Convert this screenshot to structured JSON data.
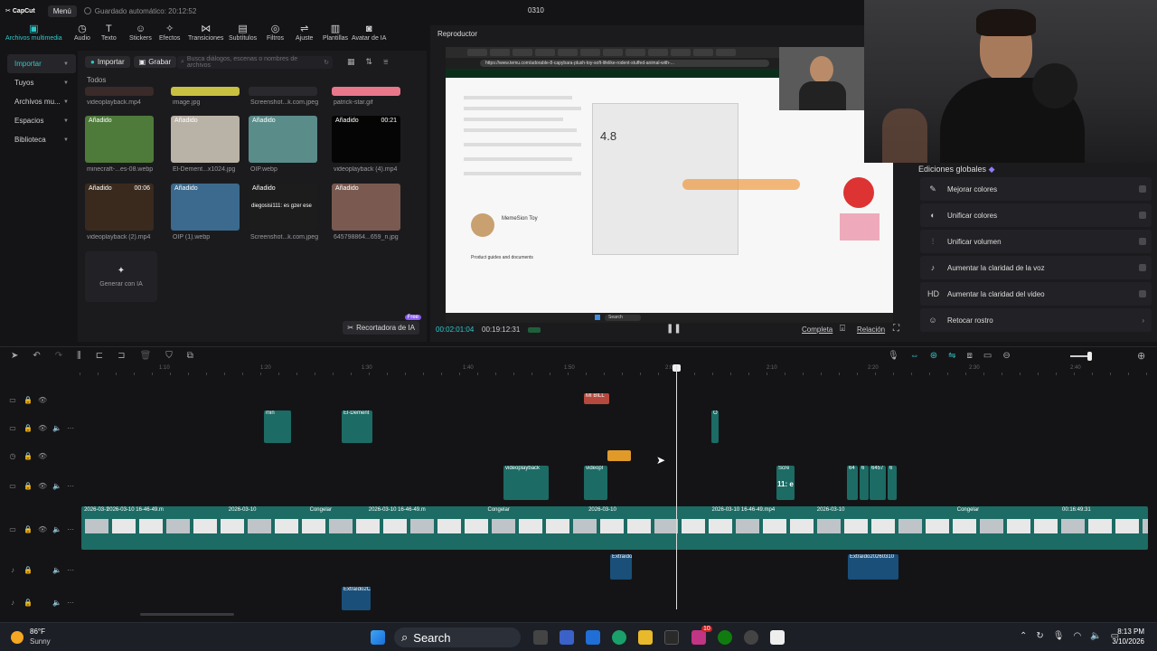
{
  "app": {
    "logo": "CapCut",
    "menu": "Menú",
    "autosave": "Guardado automático: 20:12:52",
    "project_title": "0310"
  },
  "toolbar": [
    {
      "label": "Archivos multimedia",
      "icon": "media-icon",
      "glyph": "▣",
      "active": true
    },
    {
      "label": "Audio",
      "icon": "audio-icon",
      "glyph": "◷"
    },
    {
      "label": "Texto",
      "icon": "text-icon",
      "glyph": "T"
    },
    {
      "label": "Stickers",
      "icon": "sticker-icon",
      "glyph": "☺"
    },
    {
      "label": "Efectos",
      "icon": "effects-icon",
      "glyph": "✧"
    },
    {
      "label": "Transiciones",
      "icon": "transitions-icon",
      "glyph": "⋈"
    },
    {
      "label": "Subtítulos",
      "icon": "subtitles-icon",
      "glyph": "▤"
    },
    {
      "label": "Filtros",
      "icon": "filters-icon",
      "glyph": "◎"
    },
    {
      "label": "Ajuste",
      "icon": "adjust-icon",
      "glyph": "⇌"
    },
    {
      "label": "Plantillas",
      "icon": "templates-icon",
      "glyph": "▥"
    },
    {
      "label": "Avatar de IA",
      "icon": "ai-avatar-icon",
      "glyph": "◙"
    }
  ],
  "nav": [
    {
      "label": "Importar",
      "active": true
    },
    {
      "label": "Tuyos"
    },
    {
      "label": "Archivos mu..."
    },
    {
      "label": "Espacios"
    },
    {
      "label": "Biblioteca"
    }
  ],
  "media": {
    "import_btn": "Importar",
    "record_btn": "Grabar",
    "search_placeholder": "Busca diálogos, escenas o nombres de archivos",
    "section": "Todos",
    "top_names": [
      "videoplayback.mp4",
      "image.jpg",
      "Screenshot...k.com.jpeg",
      "patrick-star.gif"
    ],
    "items": [
      {
        "badge": "Añadido",
        "duration": "",
        "name": "minecraft-...es-08.webp",
        "color": "#4e7a3a"
      },
      {
        "badge": "Añadido",
        "duration": "",
        "name": "El-Dement...x1024.jpg",
        "color": "#b9b2a6"
      },
      {
        "badge": "Añadido",
        "duration": "",
        "name": "OIP.webp",
        "color": "#5a8c8a"
      },
      {
        "badge": "Añadido",
        "duration": "00:21",
        "name": "videoplayback (4).mp4",
        "color": "#050505"
      },
      {
        "badge": "Añadido",
        "duration": "00:06",
        "name": "videoplayback (2).mp4",
        "color": "#3a2a1e"
      },
      {
        "badge": "Añadido",
        "duration": "",
        "name": "OIP (1).webp",
        "color": "#3c6a8e"
      },
      {
        "badge": "Añadido",
        "duration": "",
        "name": "Screenshot...k.com.jpeg",
        "color": "#1c1c1c",
        "overlay": "diegosisi111: es gzer ese"
      },
      {
        "badge": "Añadido",
        "duration": "",
        "name": "645798864...659_n.jpg",
        "color": "#7a5a50"
      }
    ],
    "generate_label": "Generar con IA",
    "recorta_label": "Recortadora de IA",
    "free_badge": "Free"
  },
  "player": {
    "title": "Reproductor",
    "current_time": "00:02:01:04",
    "total_time": "00:19:12:31",
    "full_label": "Completa",
    "ratio_label": "Relación",
    "url": "https://www.temu.com/adorable-8-capybara-plush-toy-soft-lifelike-rodent-stuffed-animal-with-...",
    "rating": "4.8",
    "seller": "MemeSion Toy",
    "section_text": "Product guides and documents",
    "search_label": "Search"
  },
  "global_edits": {
    "title": "Ediciones globales",
    "items": [
      {
        "label": "Mejorar colores",
        "icon": "enhance-colors-icon",
        "glyph": "✎"
      },
      {
        "label": "Unificar colores",
        "icon": "unify-colors-icon",
        "glyph": "◐"
      },
      {
        "label": "Unificar volumen",
        "icon": "unify-volume-icon",
        "glyph": "⫶"
      },
      {
        "label": "Aumentar la claridad de la voz",
        "icon": "voice-clarity-icon",
        "glyph": "♪"
      },
      {
        "label": "Aumentar la claridad del video",
        "icon": "video-clarity-icon",
        "glyph": "HD"
      },
      {
        "label": "Retocar rostro",
        "icon": "retouch-face-icon",
        "glyph": "☺"
      }
    ]
  },
  "timeline": {
    "ticks": [
      "1:10",
      "1:20",
      "1:30",
      "1:40",
      "1:50",
      "2:00",
      "2:10",
      "2:20",
      "2:30",
      "2:40"
    ],
    "text_clip": "MI BILL",
    "clips_video": [
      "min",
      "El-Dement",
      "O"
    ],
    "clips_video2": [
      "videoplayback",
      "videopl",
      "Scre",
      "64",
      "6",
      "6457",
      "6"
    ],
    "overlay_text": "11: e",
    "main_labels": [
      "2026-03-1",
      "2026-03-10 16-46-49.m",
      "2026-03-10",
      "Congelar",
      "2026-03-10 16-46-49.m",
      "Congelar",
      "2026-03-10",
      "2026-03-10 16-46-49.mp4",
      "2026-03-10",
      "Congelar",
      "00:16:49:31"
    ],
    "audio_clips": [
      "Extraído",
      "Extraído20260310",
      "Extraído2C"
    ]
  },
  "taskbar": {
    "weather_temp": "86°F",
    "weather_desc": "Sunny",
    "search": "Search",
    "time": "8:13 PM",
    "date": "3/10/2026",
    "badge_count": "10"
  }
}
